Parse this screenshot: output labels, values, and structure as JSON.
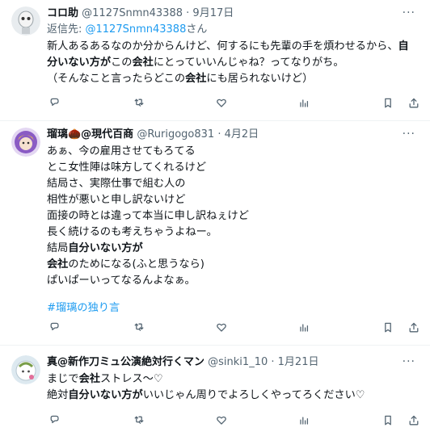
{
  "tweets": [
    {
      "name": "コロ助",
      "handle": "@1127Snmn43388",
      "sep": "·",
      "date": "9月17日",
      "more": "···",
      "reply_to": {
        "prefix": "返信先: ",
        "mention": "@1127Snmn43388",
        "suffix": "さん"
      },
      "lines": [
        [
          {
            "t": "新人あるあるなのか分からんけど、何するにも先輩の手を煩わせるから、",
            "b": false
          },
          {
            "t": "自",
            "b": true
          }
        ],
        [
          {
            "t": "分いない方が",
            "b": true
          },
          {
            "t": "この",
            "b": false
          },
          {
            "t": "会社",
            "b": true
          },
          {
            "t": "にとっていいんじゃね？ってなりがち。",
            "b": false
          }
        ],
        [
          {
            "t": "（そんなこと言ったらどこの",
            "b": false
          },
          {
            "t": "会社",
            "b": true
          },
          {
            "t": "にも居られないけど）",
            "b": false
          }
        ]
      ]
    },
    {
      "name": "瑠璃🌰@現代百商",
      "handle": "@Rurigogo831",
      "sep": "·",
      "date": "4月2日",
      "more": "···",
      "lines": [
        [
          {
            "t": "あぁ、今の雇用させてもろてる",
            "b": false
          }
        ],
        [
          {
            "t": "とこ女性陣は味方してくれるけど",
            "b": false
          }
        ],
        [
          {
            "t": "結局さ、実際仕事で組む人の",
            "b": false
          }
        ],
        [
          {
            "t": "相性が悪いと申し訳ないけど",
            "b": false
          }
        ],
        [
          {
            "t": "面接の時とは違って本当に申し訳ねぇけど",
            "b": false
          }
        ],
        [
          {
            "t": "長く続けるのも考えちゃうよねー。",
            "b": false
          }
        ],
        [
          {
            "t": "結局",
            "b": false
          },
          {
            "t": "自分いない方が",
            "b": true
          }
        ],
        [
          {
            "t": "会社",
            "b": true
          },
          {
            "t": "のためになる(ふと思うなら)",
            "b": false
          }
        ],
        [
          {
            "t": "ぱいぱーいってなるんよなぁ。",
            "b": false
          }
        ]
      ],
      "hashtag": "#瑠璃の独り言"
    },
    {
      "name": "真@新作刀ミュ公演絶対行くマン",
      "handle": "@sinki1_10",
      "sep": "·",
      "date": "1月21日",
      "more": "···",
      "lines": [
        [
          {
            "t": "まじで",
            "b": false
          },
          {
            "t": "会社",
            "b": true
          },
          {
            "t": "ストレス～♡",
            "b": false
          }
        ],
        [
          {
            "t": "絶対",
            "b": false
          },
          {
            "t": "自分いない方が",
            "b": true
          },
          {
            "t": "いいじゃん周りでよろしくやってろください♡",
            "b": false
          }
        ]
      ]
    }
  ],
  "action_icons": [
    "reply-icon",
    "retweet-icon",
    "like-icon",
    "views-icon",
    "bookmark-icon",
    "share-icon"
  ],
  "colors": {
    "text": "#0f1419",
    "muted": "#536471",
    "accent": "#1d9bf0",
    "border": "#eff3f4"
  }
}
